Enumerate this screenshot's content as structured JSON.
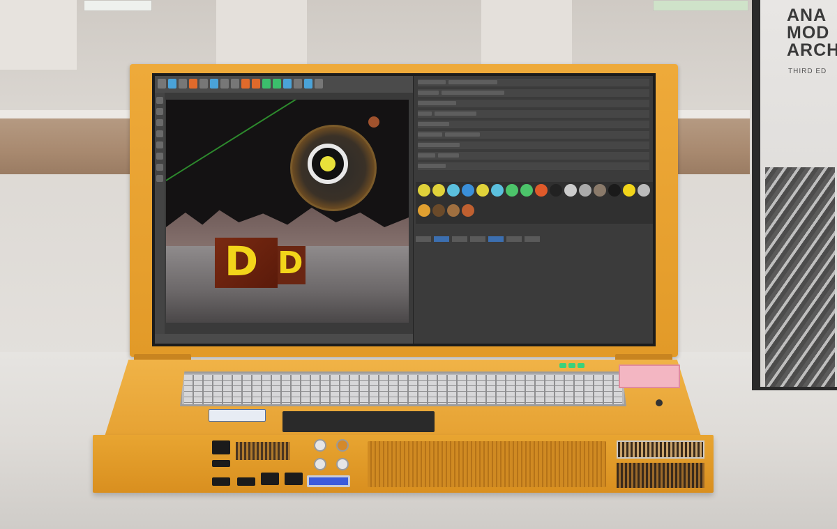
{
  "book": {
    "title_lines": [
      "ANA",
      "MOD",
      "ARCH"
    ],
    "subtitle": "THIRD ED"
  },
  "screen": {
    "viewport_letters": [
      "D",
      "D"
    ]
  },
  "colors": {
    "laptop_body": "#e6a233",
    "screen_bg": "#3a3a3a",
    "accent_yellow": "#f2d51a",
    "status_led": "#3cd17a"
  },
  "icons": [
    "toolbar-icons",
    "material-spheres",
    "usb-port",
    "ethernet-port",
    "vga-port",
    "power-button"
  ]
}
